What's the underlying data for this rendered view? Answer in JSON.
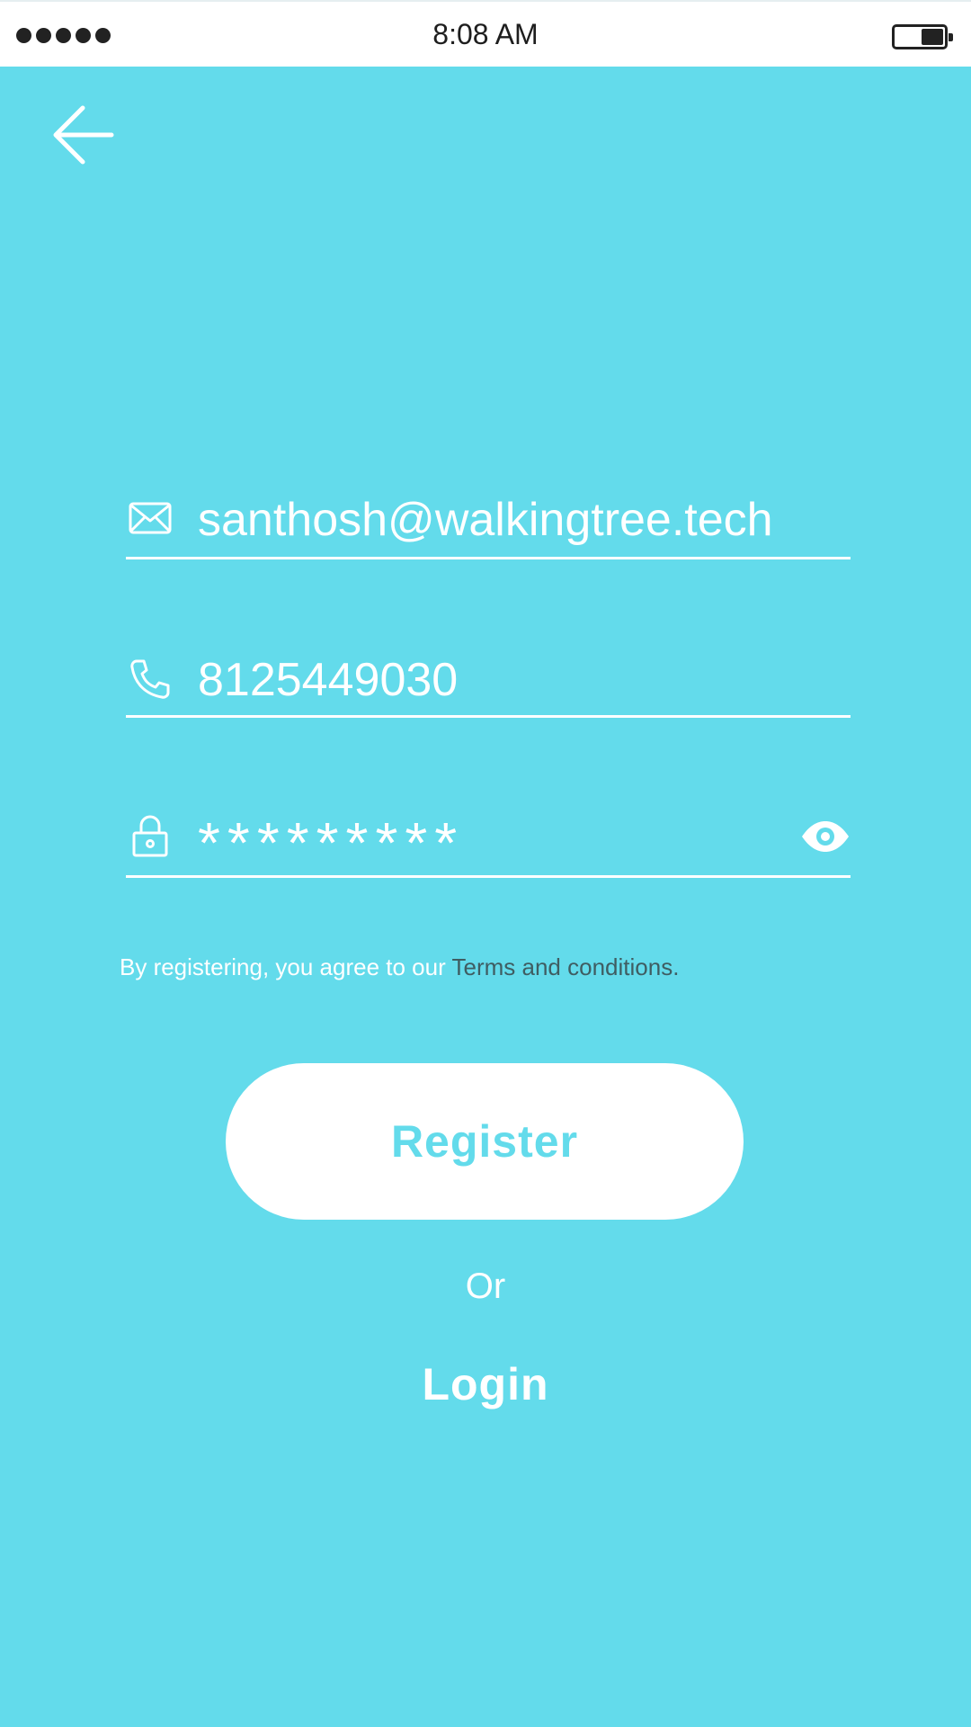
{
  "status_bar": {
    "time": "8:08 AM",
    "signal_dots": 5
  },
  "navigation": {
    "back_icon": "arrow-left-icon"
  },
  "form": {
    "email": {
      "icon": "envelope-icon",
      "value": "santhosh@walkingtree.tech"
    },
    "phone": {
      "icon": "phone-icon",
      "value": "8125449030"
    },
    "password": {
      "icon": "lock-icon",
      "value": "*********",
      "toggle_icon": "eye-icon"
    }
  },
  "terms": {
    "prefix": "By registering, you agree to our ",
    "link": "Terms and conditions."
  },
  "actions": {
    "register_label": "Register",
    "or_label": "Or",
    "login_label": "Login"
  },
  "colors": {
    "background": "#63dbeb",
    "foreground": "#ffffff",
    "terms_link": "#3f5d62",
    "status_bar": "#ffffff"
  }
}
